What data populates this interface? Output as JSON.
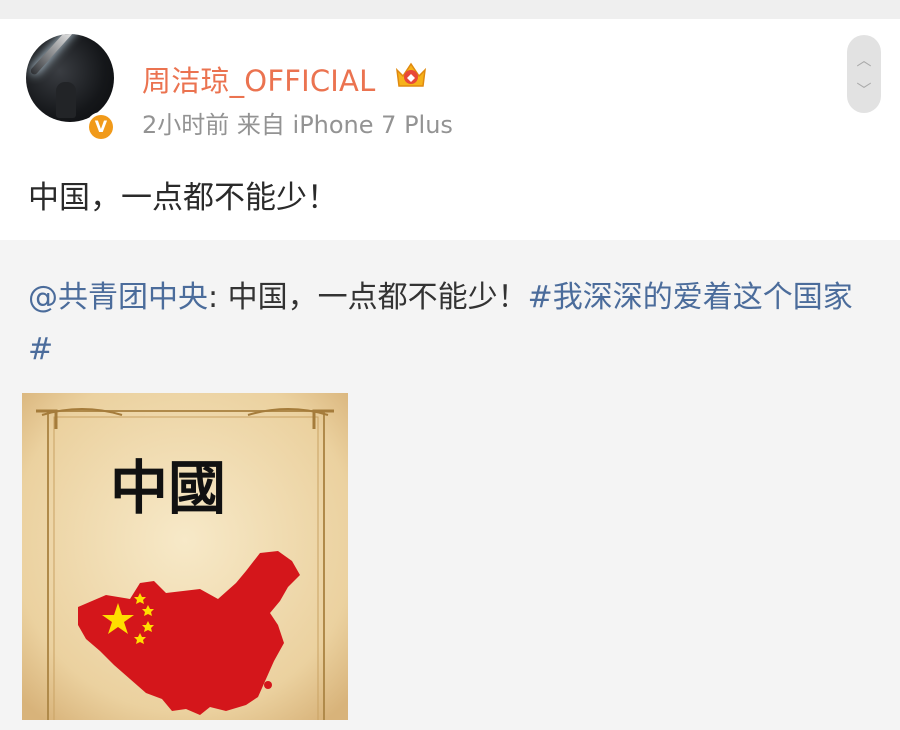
{
  "post": {
    "username": "周洁琼_OFFICIAL",
    "verified_badge": "V",
    "meta": "2小时前 来自 iPhone 7 Plus",
    "text": "中国，一点都不能少！"
  },
  "repost": {
    "mention": "@共青团中央",
    "separator": ": ",
    "text": "中国，一点都不能少！",
    "hashtag_line1": "#我深深的爱着这个国家",
    "hashtag_line2": "#",
    "image_title": "中國"
  },
  "scroll": {
    "up_icon": "chevron-up-icon",
    "down_icon": "chevron-down-icon",
    "up_glyph": "︿",
    "down_glyph": "﹀"
  },
  "icons": [
    "avatar",
    "verified-badge-icon",
    "crown-member-icon",
    "chevron-up-icon",
    "chevron-down-icon"
  ],
  "colors": {
    "username": "#eb7350",
    "link": "#4b6c9b",
    "meta": "#939393",
    "badge": "#f19a1a",
    "flag_red": "#d4161b",
    "star_yellow": "#ffde00"
  }
}
